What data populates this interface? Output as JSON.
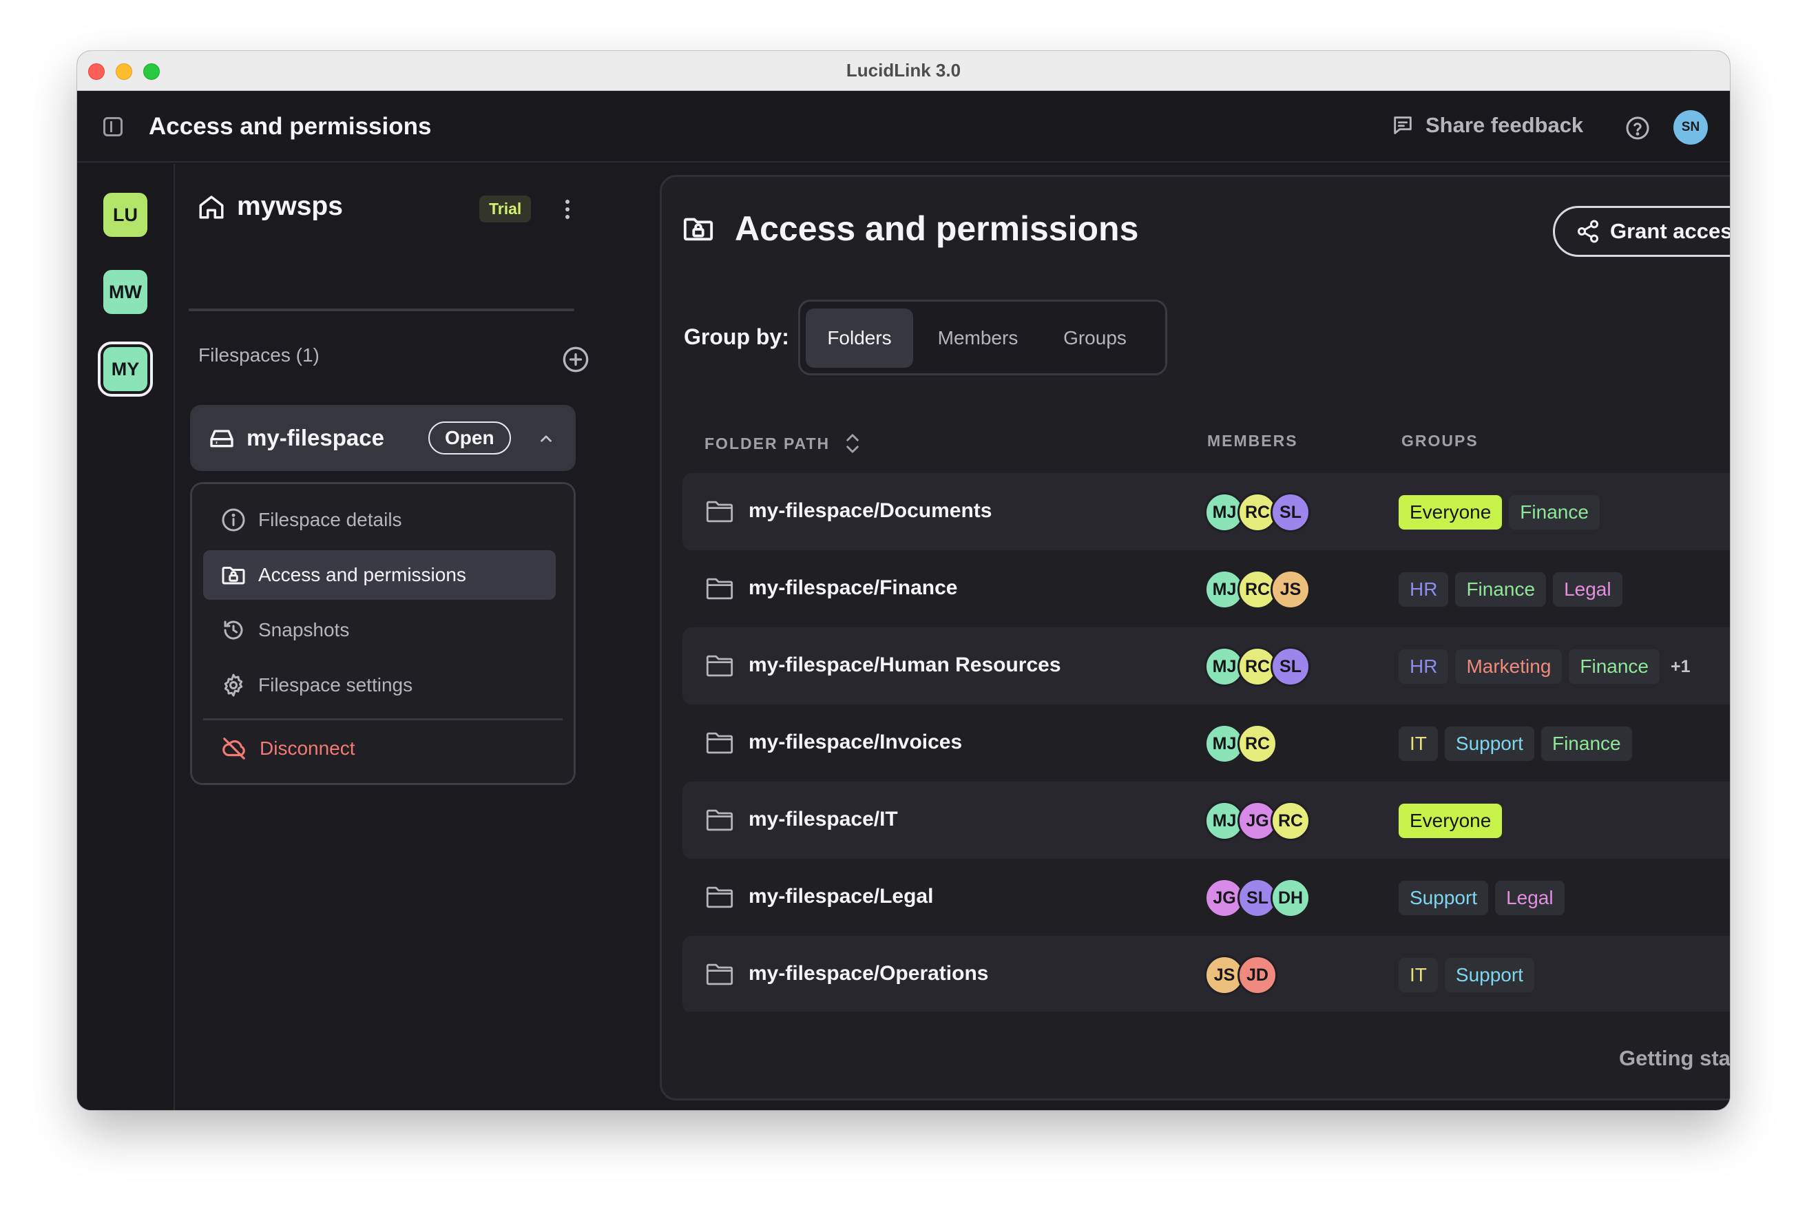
{
  "window": {
    "title": "LucidLink 3.0"
  },
  "appbar": {
    "title": "Access and permissions",
    "share_feedback": "Share feedback",
    "user_initials": "SN"
  },
  "rail": {
    "workspaces": [
      {
        "initials": "LU",
        "color": "#b3e56a"
      },
      {
        "initials": "MW",
        "color": "#8ae4b8"
      },
      {
        "initials": "MY",
        "color": "#8ae4b8",
        "selected": true
      }
    ]
  },
  "sidebar": {
    "workspace_name": "mywsps",
    "plan_badge": "Trial",
    "filespaces_heading": "Filespaces (1)",
    "filespace": {
      "name": "my-filespace",
      "status": "Open"
    },
    "menu": {
      "details": "Filespace details",
      "access": "Access and permissions",
      "snapshots": "Snapshots",
      "settings": "Filespace settings",
      "disconnect": "Disconnect"
    }
  },
  "main": {
    "title": "Access and permissions",
    "grant_button": "Grant access",
    "group_by_label": "Group by:",
    "group_by_options": {
      "folders": "Folders",
      "members": "Members",
      "groups": "Groups"
    },
    "group_by_selected": "Folders",
    "columns": {
      "path": "FOLDER PATH",
      "members": "MEMBERS",
      "groups": "GROUPS"
    },
    "footer_link": "Getting started"
  },
  "colors": {
    "tag_Everyone": "#15151a",
    "tag_Finance": "#8ee79a",
    "tag_HR": "#8e8cf0",
    "tag_Legal": "#e38ee0",
    "tag_Marketing": "#f08a7e",
    "tag_IT": "#e8e07a",
    "tag_Support": "#7cd7ef",
    "member_MJ": "#8ae4b8",
    "member_RC": "#e6ec7c",
    "member_SL": "#9c86ec",
    "member_JS": "#ecc07c",
    "member_JG": "#d88ae8",
    "member_DH": "#8ae4b8",
    "member_JD": "#f08a7e"
  },
  "rows": [
    {
      "path": "my-filespace/Documents",
      "members": [
        "MJ",
        "RC",
        "SL"
      ],
      "groups": [
        "Everyone",
        "Finance"
      ],
      "more": ""
    },
    {
      "path": "my-filespace/Finance",
      "members": [
        "MJ",
        "RC",
        "JS"
      ],
      "groups": [
        "HR",
        "Finance",
        "Legal"
      ],
      "more": ""
    },
    {
      "path": "my-filespace/Human Resources",
      "members": [
        "MJ",
        "RC",
        "SL"
      ],
      "groups": [
        "HR",
        "Marketing",
        "Finance"
      ],
      "more": "+1"
    },
    {
      "path": "my-filespace/Invoices",
      "members": [
        "MJ",
        "RC"
      ],
      "groups": [
        "IT",
        "Support",
        "Finance"
      ],
      "more": ""
    },
    {
      "path": "my-filespace/IT",
      "members": [
        "MJ",
        "JG",
        "RC"
      ],
      "groups": [
        "Everyone"
      ],
      "more": ""
    },
    {
      "path": "my-filespace/Legal",
      "members": [
        "JG",
        "SL",
        "DH"
      ],
      "groups": [
        "Support",
        "Legal"
      ],
      "more": ""
    },
    {
      "path": "my-filespace/Operations",
      "members": [
        "JS",
        "JD"
      ],
      "groups": [
        "IT",
        "Support"
      ],
      "more": ""
    }
  ]
}
